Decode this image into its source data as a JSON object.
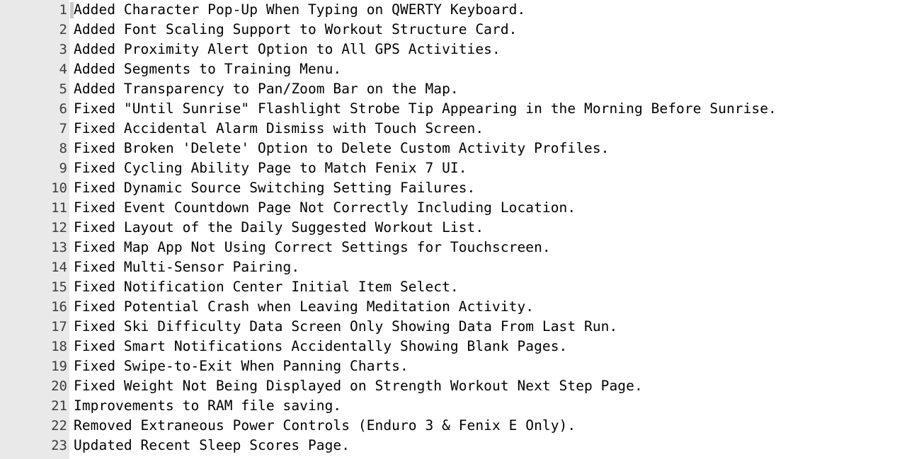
{
  "editor": {
    "type": "plain-text-changelog-view",
    "font": "monospace",
    "gutter": {
      "visible": true,
      "background_color": "#e9e9e9",
      "number_color": "#3c3c3c"
    },
    "text_color": "#000000",
    "background_color": "#ffffff",
    "caret": {
      "visible": true,
      "line": 1,
      "column": 1,
      "color": "#c8c8c8"
    },
    "line_count": 23,
    "lines": [
      {
        "number": "1",
        "text": "Added Character Pop-Up When Typing on QWERTY Keyboard."
      },
      {
        "number": "2",
        "text": "Added Font Scaling Support to Workout Structure Card."
      },
      {
        "number": "3",
        "text": "Added Proximity Alert Option to All GPS Activities."
      },
      {
        "number": "4",
        "text": "Added Segments to Training Menu."
      },
      {
        "number": "5",
        "text": "Added Transparency to Pan/Zoom Bar on the Map."
      },
      {
        "number": "6",
        "text": "Fixed \"Until Sunrise\" Flashlight Strobe Tip Appearing in the Morning Before Sunrise."
      },
      {
        "number": "7",
        "text": "Fixed Accidental Alarm Dismiss with Touch Screen."
      },
      {
        "number": "8",
        "text": "Fixed Broken 'Delete' Option to Delete Custom Activity Profiles."
      },
      {
        "number": "9",
        "text": "Fixed Cycling Ability Page to Match Fenix 7 UI."
      },
      {
        "number": "10",
        "text": "Fixed Dynamic Source Switching Setting Failures."
      },
      {
        "number": "11",
        "text": "Fixed Event Countdown Page Not Correctly Including Location."
      },
      {
        "number": "12",
        "text": "Fixed Layout of the Daily Suggested Workout List."
      },
      {
        "number": "13",
        "text": "Fixed Map App Not Using Correct Settings for Touchscreen."
      },
      {
        "number": "14",
        "text": "Fixed Multi-Sensor Pairing."
      },
      {
        "number": "15",
        "text": "Fixed Notification Center Initial Item Select."
      },
      {
        "number": "16",
        "text": "Fixed Potential Crash when Leaving Meditation Activity."
      },
      {
        "number": "17",
        "text": "Fixed Ski Difficulty Data Screen Only Showing Data From Last Run."
      },
      {
        "number": "18",
        "text": "Fixed Smart Notifications Accidentally Showing Blank Pages."
      },
      {
        "number": "19",
        "text": "Fixed Swipe-to-Exit When Panning Charts."
      },
      {
        "number": "20",
        "text": "Fixed Weight Not Being Displayed on Strength Workout Next Step Page."
      },
      {
        "number": "21",
        "text": "Improvements to RAM file saving."
      },
      {
        "number": "22",
        "text": "Removed Extraneous Power Controls (Enduro 3 & Fenix E Only)."
      },
      {
        "number": "23",
        "text": "Updated Recent Sleep Scores Page."
      }
    ]
  }
}
